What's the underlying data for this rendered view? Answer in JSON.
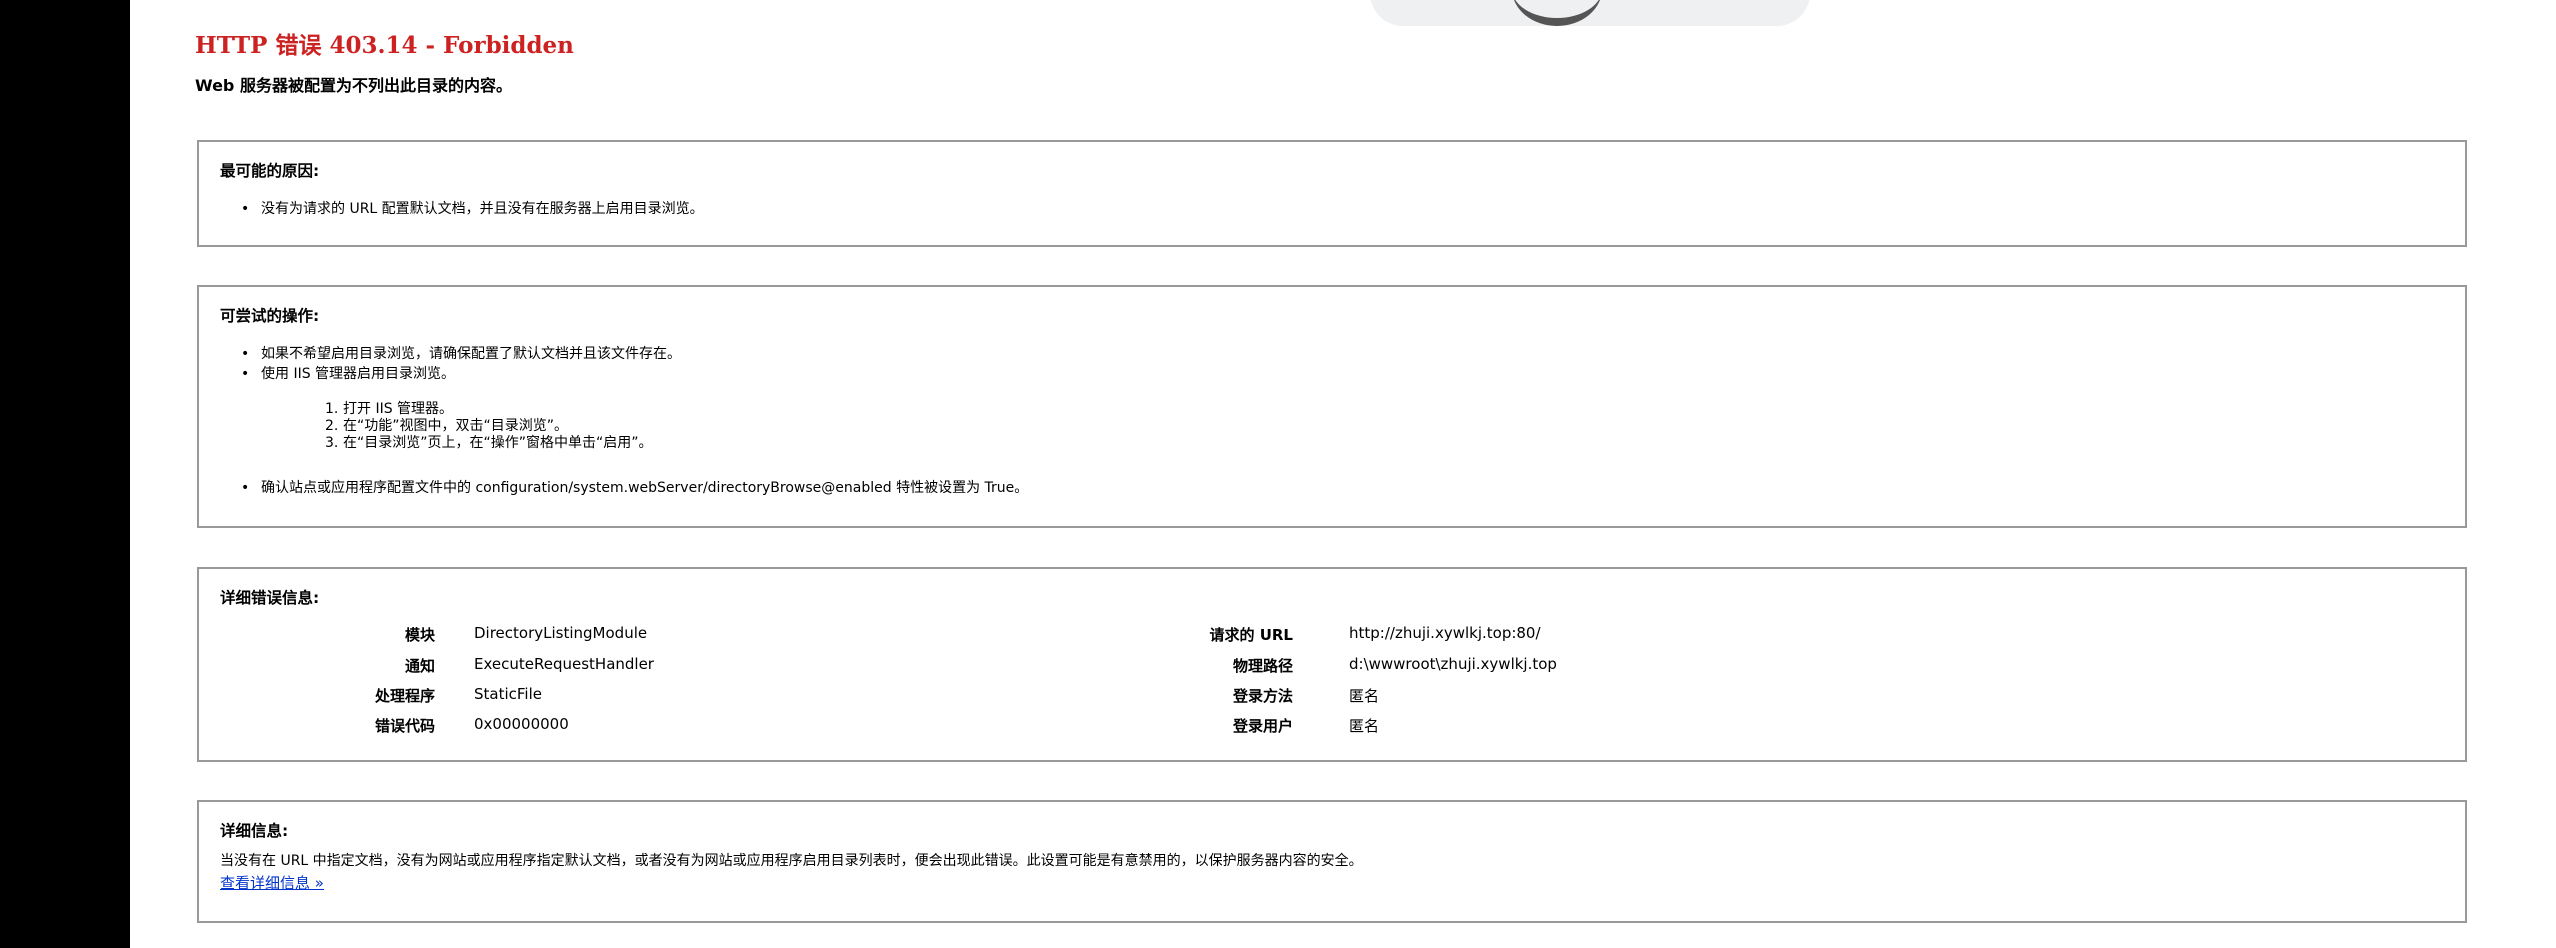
{
  "error": {
    "title": "HTTP 错误 403.14 - Forbidden",
    "subtitle": "Web 服务器被配置为不列出此目录的内容。"
  },
  "causes": {
    "heading": "最可能的原因:",
    "items": [
      "没有为请求的 URL 配置默认文档，并且没有在服务器上启用目录浏览。"
    ]
  },
  "actions": {
    "heading": "可尝试的操作:",
    "items": [
      "如果不希望启用目录浏览，请确保配置了默认文档并且该文件存在。",
      "使用 IIS 管理器启用目录浏览。",
      "确认站点或应用程序配置文件中的 configuration/system.webServer/directoryBrowse@enabled 特性被设置为 True。"
    ],
    "steps": [
      {
        "num": "1.",
        "text": "打开 IIS 管理器。"
      },
      {
        "num": "2.",
        "text": "在“功能”视图中，双击“目录浏览”。"
      },
      {
        "num": "3.",
        "text": "在“目录浏览”页上，在“操作”窗格中单击“启用”。"
      }
    ]
  },
  "details": {
    "heading": "详细错误信息:",
    "left": [
      {
        "label": "模块",
        "value": "DirectoryListingModule"
      },
      {
        "label": "通知",
        "value": "ExecuteRequestHandler"
      },
      {
        "label": "处理程序",
        "value": "StaticFile"
      },
      {
        "label": "错误代码",
        "value": "0x00000000"
      }
    ],
    "right": [
      {
        "label": "请求的 URL",
        "value": "http://zhuji.xywlkj.top:80/"
      },
      {
        "label": "物理路径",
        "value": "d:\\wwwroot\\zhuji.xywlkj.top"
      },
      {
        "label": "登录方法",
        "value": "匿名"
      },
      {
        "label": "登录用户",
        "value": "匿名"
      }
    ]
  },
  "more_info": {
    "heading": "详细信息:",
    "text": "当没有在 URL 中指定文档，没有为网站或应用程序指定默认文档，或者没有为网站或应用程序启用目录列表时，便会出现此错误。此设置可能是有意禁用的，以保护服务器内容的安全。",
    "link": "查看详细信息 »"
  }
}
